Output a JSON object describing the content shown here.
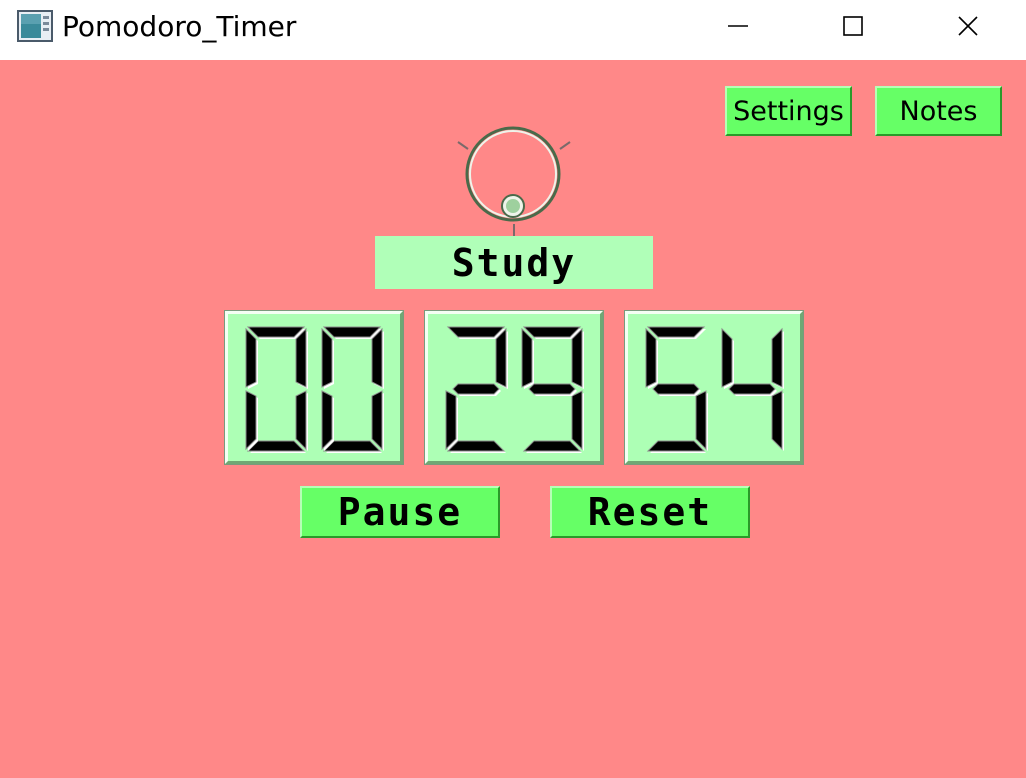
{
  "window": {
    "title": "Pomodoro_Timer",
    "minimize_icon": "minimize-icon",
    "maximize_icon": "maximize-icon",
    "close_icon": "close-icon"
  },
  "toolbar": {
    "settings_label": "Settings",
    "notes_label": "Notes"
  },
  "mode": {
    "label": "Study"
  },
  "timer": {
    "hours": "00",
    "minutes": "29",
    "seconds": "54"
  },
  "controls": {
    "pause_label": "Pause",
    "reset_label": "Reset"
  },
  "colors": {
    "background": "#ff8888",
    "button": "#66ff66",
    "panel": "#adffb5",
    "mode_box": "#b0ffb8"
  }
}
